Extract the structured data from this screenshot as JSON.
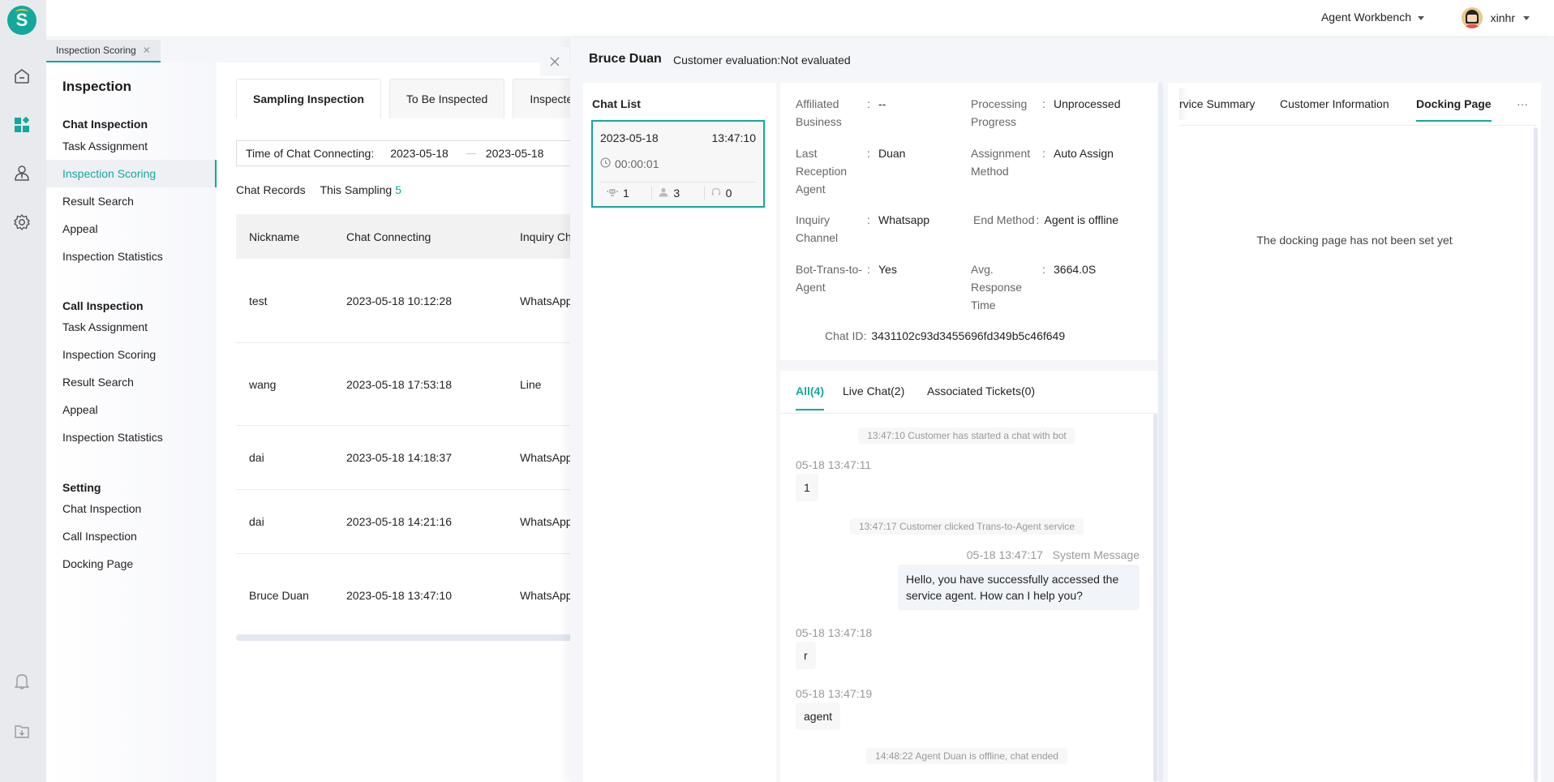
{
  "colors": {
    "accent": "#14a89c",
    "rail_bg": "#e8eaee"
  },
  "rail": {
    "logo_letter": "S",
    "icons": [
      "home-icon",
      "dashboard-icon",
      "agent-icon",
      "settings-icon",
      "bell-icon",
      "download-folder-icon"
    ]
  },
  "topbar": {
    "workbench_label": "Agent Workbench",
    "username": "xinhr"
  },
  "page_tab": {
    "label": "Inspection Scoring",
    "close": "✕"
  },
  "subnav": {
    "title": "Inspection",
    "groups": [
      {
        "label": "Chat Inspection",
        "items": [
          "Task Assignment",
          "Inspection Scoring",
          "Result Search",
          "Appeal",
          "Inspection Statistics"
        ]
      },
      {
        "label": "Call Inspection",
        "items": [
          "Task Assignment",
          "Inspection Scoring",
          "Result Search",
          "Appeal",
          "Inspection Statistics"
        ]
      },
      {
        "label": "Setting",
        "items": [
          "Chat Inspection",
          "Call Inspection",
          "Docking Page"
        ]
      }
    ],
    "active_item": "Inspection Scoring"
  },
  "main": {
    "tabs": [
      "Sampling Inspection",
      "To Be Inspected",
      "Inspected"
    ],
    "active_tab": "Sampling Inspection",
    "filter": {
      "label": "Time of Chat Connecting:",
      "start": "2023-05-18",
      "end": "2023-05-18"
    },
    "records_label": "Chat Records",
    "sampling_label": "This Sampling",
    "sampling_count": "5",
    "table": {
      "headers": [
        "Nickname",
        "Chat Connecting",
        "Inquiry Channel"
      ],
      "rows": [
        {
          "nickname": "test",
          "connecting": "2023-05-18 10:12:28",
          "channel": "WhatsApp"
        },
        {
          "nickname": "wang",
          "connecting": "2023-05-18 17:53:18",
          "channel": "Line"
        },
        {
          "nickname": "dai",
          "connecting": "2023-05-18 14:18:37",
          "channel": "WhatsApp"
        },
        {
          "nickname": "dai",
          "connecting": "2023-05-18 14:21:16",
          "channel": "WhatsApp"
        },
        {
          "nickname": "Bruce Duan",
          "connecting": "2023-05-18 13:47:10",
          "channel": "WhatsApp"
        }
      ]
    }
  },
  "drawer": {
    "customer_name": "Bruce Duan",
    "evaluation": "Customer evaluation:Not evaluated",
    "chat_list": {
      "title": "Chat List",
      "card": {
        "date": "2023-05-18",
        "time": "13:47:10",
        "duration": "00:00:01",
        "bot_count": "1",
        "customer_count": "3",
        "agent_count": "0"
      }
    },
    "info": {
      "affiliated_business": {
        "label": "Affiliated Business",
        "value": "--"
      },
      "processing_progress": {
        "label": "Processing Progress",
        "value": "Unprocessed"
      },
      "last_reception_agent": {
        "label": "Last Reception Agent",
        "value": "Duan"
      },
      "assignment_method": {
        "label": "Assignment Method",
        "value": "Auto Assign"
      },
      "inquiry_channel": {
        "label": "Inquiry Channel",
        "value": "Whatsapp"
      },
      "end_method": {
        "label": "End Method",
        "value": "Agent is offline"
      },
      "bot_trans": {
        "label": "Bot-Trans-to-Agent",
        "value": "Yes"
      },
      "avg_response": {
        "label": "Avg. Response Time",
        "value": "3664.0S"
      },
      "chat_id": {
        "label": "Chat ID",
        "value": "3431102c93d3455696fd349b5c46f649"
      },
      "colon": ":"
    },
    "message_tabs": [
      "All(4)",
      "Live Chat(2)",
      "Associated Tickets(0)"
    ],
    "active_message_tab": "All(4)",
    "messages": {
      "sys1": "13:47:10 Customer has started a chat with bot",
      "m1_time": "05-18 13:47:11",
      "m1_text": "1",
      "sys2": "13:47:17 Customer clicked Trans-to-Agent service",
      "m2_time": "05-18 13:47:17",
      "m2_sender": "System Message",
      "m2_text": "Hello, you have successfully accessed the service agent. How can I help you?",
      "m3_time": "05-18 13:47:18",
      "m3_text": "r",
      "m4_time": "05-18 13:47:19",
      "m4_text": "agent",
      "sys3": "14:48:22 Agent Duan is offline, chat ended"
    },
    "right_tabs": [
      "rvice Summary",
      "Customer Information",
      "Docking Page",
      "···"
    ],
    "active_right_tab": "Docking Page",
    "right_empty": "The docking page has not been set yet"
  }
}
